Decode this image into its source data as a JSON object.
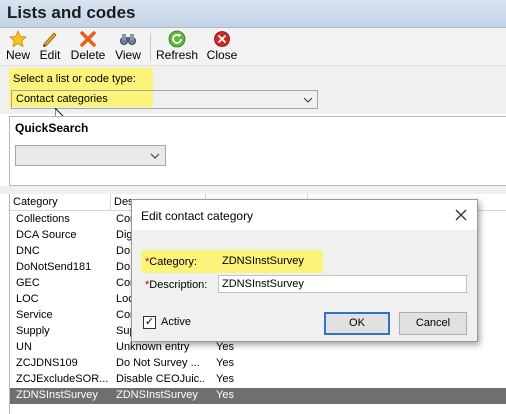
{
  "window": {
    "title": "Lists and codes"
  },
  "toolbar": {
    "new_label": "New",
    "edit_label": "Edit",
    "delete_label": "Delete",
    "view_label": "View",
    "refresh_label": "Refresh",
    "close_label": "Close"
  },
  "selector": {
    "label": "Select a list or code type:",
    "value": "Contact categories"
  },
  "quicksearch": {
    "title": "QuickSearch",
    "value": ""
  },
  "table": {
    "headers": [
      "Category",
      "Des"
    ],
    "rows": [
      {
        "category": "Collections",
        "description": "Con",
        "active": ""
      },
      {
        "category": "DCA Source",
        "description": "Digi",
        "active": ""
      },
      {
        "category": "DNC",
        "description": "Do",
        "active": ""
      },
      {
        "category": "DoNotSend181",
        "description": "Do",
        "active": ""
      },
      {
        "category": "GEC",
        "description": "Con",
        "active": ""
      },
      {
        "category": "LOC",
        "description": "Loc",
        "active": ""
      },
      {
        "category": "Service",
        "description": "Con",
        "active": ""
      },
      {
        "category": "Supply",
        "description": "Sup",
        "active": ""
      },
      {
        "category": "UN",
        "description": "Unknown entry",
        "active": "Yes"
      },
      {
        "category": "ZCJDNS109",
        "description": "Do Not Survey ...",
        "active": "Yes"
      },
      {
        "category": "ZCJExcludeSOR...",
        "description": "Disable CEOJuic...",
        "active": "Yes"
      },
      {
        "category": "ZDNSInstSurvey",
        "description": "ZDNSInstSurvey",
        "active": "Yes"
      }
    ]
  },
  "dialog": {
    "title": "Edit contact category",
    "category_label": "Category:",
    "category_value": "ZDNSInstSurvey",
    "description_label": "Description:",
    "description_value": "ZDNSInstSurvey",
    "active_label": "Active",
    "active_checked": "✓",
    "required_mark": "*",
    "ok_label": "OK",
    "cancel_label": "Cancel"
  },
  "icons": [
    "star-icon",
    "pencil-icon",
    "delete-x-icon",
    "binoculars-icon",
    "refresh-icon",
    "close-circle-icon",
    "chevron-down-icon",
    "mouse-cursor-icon",
    "close-icon"
  ],
  "colors": {
    "highlight": "#fbf37a",
    "selected_row": "#707070",
    "default_button_border": "#2f73c4"
  }
}
